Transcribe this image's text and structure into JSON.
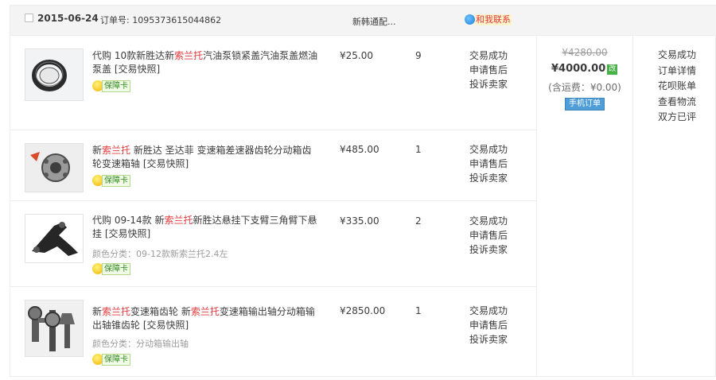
{
  "order": {
    "date": "2015-06-24",
    "order_label": "订单号: 1095373615044862",
    "shop": "新韩通配...",
    "contact": "和我联系"
  },
  "items": [
    {
      "title_parts": [
        "代购 10款新胜达新",
        "索兰托",
        "汽油泵锁紧盖汽油泵盖燃油泵盖"
      ],
      "snapshot": "[交易快照]",
      "variant": "",
      "badge": "保障卡",
      "price": "¥25.00",
      "qty": "9",
      "actions": [
        "交易成功",
        "申请售后",
        "投诉卖家"
      ],
      "thumb": "oil-seal"
    },
    {
      "title_parts": [
        "新",
        "索兰托",
        " 新胜达 圣达菲 变速箱差速器齿轮分动箱齿轮变速箱轴"
      ],
      "snapshot": "[交易快照]",
      "variant": "",
      "badge": "保障卡",
      "price": "¥485.00",
      "qty": "1",
      "actions": [
        "交易成功",
        "申请售后",
        "投诉卖家"
      ],
      "thumb": "differential-case"
    },
    {
      "title_parts": [
        "代购 09-14款 新",
        "索兰托",
        "新胜达悬挂下支臂三角臂下悬挂"
      ],
      "snapshot": "[交易快照]",
      "variant": "颜色分类：09-12款新索兰托2.4左",
      "badge": "保障卡",
      "price": "¥335.00",
      "qty": "2",
      "actions": [
        "交易成功",
        "申请售后",
        "投诉卖家"
      ],
      "thumb": "control-arm"
    },
    {
      "title_parts": [
        "新",
        "索兰托",
        "变速箱齿轮 新",
        "索兰托",
        "变速箱输出轴分动箱输出轴锥齿轮"
      ],
      "snapshot": "[交易快照]",
      "variant": "颜色分类：分动箱输出轴",
      "badge": "保障卡",
      "price": "¥2850.00",
      "qty": "1",
      "actions": [
        "交易成功",
        "申请售后",
        "投诉卖家"
      ],
      "thumb": "bevel-gear-shaft"
    }
  ],
  "summary": {
    "original_price": "¥4280.00",
    "total": "¥4000.00",
    "changed_icon": "改",
    "shipping": "(含运费：¥0.00)",
    "mobile_order": "手机订单"
  },
  "status_links": [
    "交易成功",
    "订单详情",
    "花呗账单",
    "查看物流",
    "双方已评"
  ],
  "colors": {
    "highlight": "#e4393c",
    "header_bg": "#f4f4f4",
    "badge_green": "#2f8b1f",
    "mobile_blue": "#4f9ed8"
  }
}
